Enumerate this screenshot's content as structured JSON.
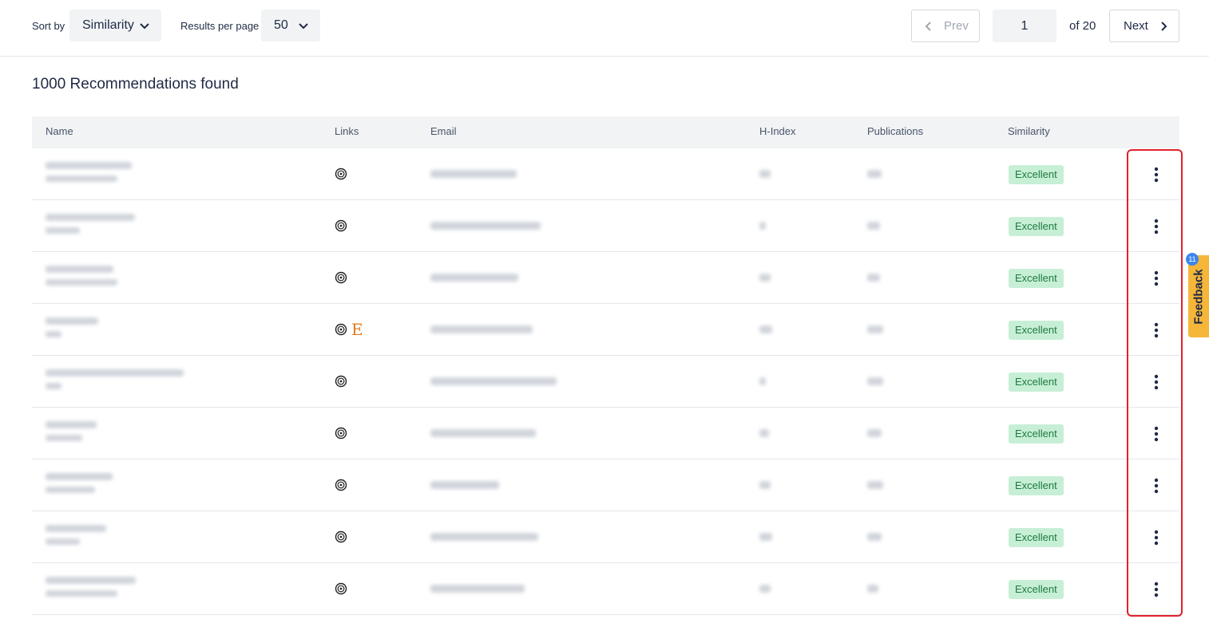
{
  "toolbar": {
    "sort_label": "Sort by",
    "sort_value": "Similarity",
    "per_page_label": "Results per page",
    "per_page_value": "50",
    "prev_label": "Prev",
    "page_value": "1",
    "page_of": "of 20",
    "next_label": "Next"
  },
  "results_heading": "1000 Recommendations found",
  "table": {
    "columns": [
      "Name",
      "Links",
      "Email",
      "H-Index",
      "Publications",
      "Similarity"
    ],
    "rows": [
      {
        "similarity": "Excellent",
        "links": [
          "orcid-icon"
        ]
      },
      {
        "similarity": "Excellent",
        "links": [
          "orcid-icon"
        ]
      },
      {
        "similarity": "Excellent",
        "links": [
          "orcid-icon"
        ]
      },
      {
        "similarity": "Excellent",
        "links": [
          "orcid-icon",
          "elsevier-icon"
        ],
        "elsevier_letter": "E"
      },
      {
        "similarity": "Excellent",
        "links": [
          "orcid-icon"
        ]
      },
      {
        "similarity": "Excellent",
        "links": [
          "orcid-icon"
        ]
      },
      {
        "similarity": "Excellent",
        "links": [
          "orcid-icon"
        ]
      },
      {
        "similarity": "Excellent",
        "links": [
          "orcid-icon"
        ]
      },
      {
        "similarity": "Excellent",
        "links": [
          "orcid-icon"
        ]
      }
    ]
  },
  "feedback": {
    "label": "Feedback",
    "count": "11"
  },
  "colors": {
    "badge_bg": "#c7efd6",
    "badge_text": "#1e7a3e",
    "highlight": "#e0212b",
    "feedback_bg": "#f5b63a",
    "elsevier": "#e07a1f"
  }
}
